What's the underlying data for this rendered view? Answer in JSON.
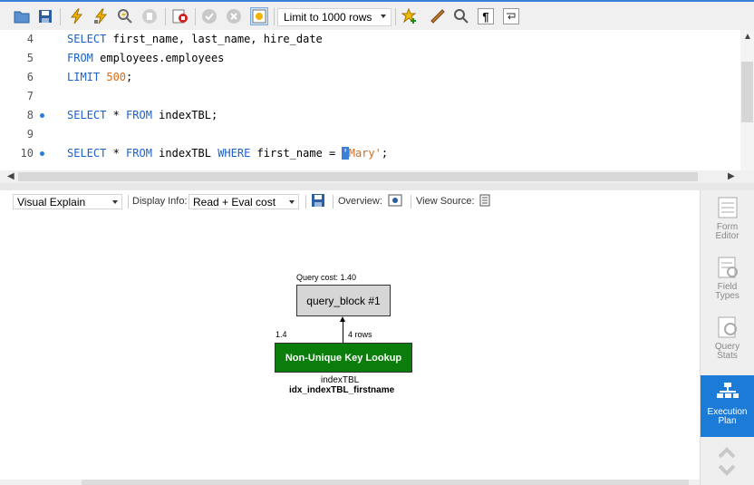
{
  "toolbar": {
    "limit_select": "Limit to 1000 rows",
    "icons": [
      "folder-open-icon",
      "save-icon",
      "execute-icon",
      "execute-current-icon",
      "explain-icon",
      "stop-icon",
      "toggle-continue-icon",
      "commit-icon",
      "rollback-icon",
      "autocommit-icon",
      "favorite-add-icon",
      "beautify-icon",
      "find-icon",
      "invisible-chars-icon",
      "wrap-icon"
    ]
  },
  "editor": {
    "lines": [
      {
        "num": "4",
        "dot": false
      },
      {
        "num": "5",
        "dot": false
      },
      {
        "num": "6",
        "dot": false
      },
      {
        "num": "7",
        "dot": false
      },
      {
        "num": "8",
        "dot": true
      },
      {
        "num": "9",
        "dot": false
      },
      {
        "num": "10",
        "dot": true
      }
    ],
    "tokens": {
      "l4_kw": "SELECT",
      "l4_rest": " first_name, last_name, hire_date",
      "l5_kw": "FROM",
      "l5_rest": " employees.employees",
      "l6_kw": "LIMIT",
      "l6_num": "500",
      "l6_end": ";",
      "l8_kw1": "SELECT",
      "l8_mid": " * ",
      "l8_kw2": "FROM",
      "l8_rest": " indexTBL;",
      "l10_kw1": "SELECT",
      "l10_mid": " * ",
      "l10_kw2": "FROM",
      "l10_mid2": " indexTBL ",
      "l10_kw3": "WHERE",
      "l10_mid3": " first_name = ",
      "l10_q": "'",
      "l10_str": "Mary'",
      "l10_end": ";"
    }
  },
  "explain_bar": {
    "mode_select": "Visual Explain",
    "display_info_label": "Display Info:",
    "display_info_select": "Read + Eval cost",
    "overview_label": "Overview:",
    "view_source_label": "View Source:"
  },
  "diagram": {
    "query_cost": "Query cost: 1.40",
    "query_block": "query_block #1",
    "cost_left": "1.4",
    "rows": "4 rows",
    "lookup_label": "Non-Unique Key Lookup",
    "table_name": "indexTBL",
    "index_name": "idx_indexTBL_firstname"
  },
  "side_panel": {
    "items": [
      {
        "label1": "Form",
        "label2": "Editor",
        "icon": "form-editor-icon"
      },
      {
        "label1": "Field",
        "label2": "Types",
        "icon": "field-types-icon"
      },
      {
        "label1": "Query",
        "label2": "Stats",
        "icon": "query-stats-icon"
      },
      {
        "label1": "Execution",
        "label2": "Plan",
        "icon": "execution-plan-icon"
      }
    ],
    "active_color": "#1b7bd7"
  },
  "colors": {
    "keyword": "#1a61c9",
    "number": "#d46c1a",
    "lookup_box": "#0a7d0a",
    "query_block_box": "#d6d6d6"
  }
}
